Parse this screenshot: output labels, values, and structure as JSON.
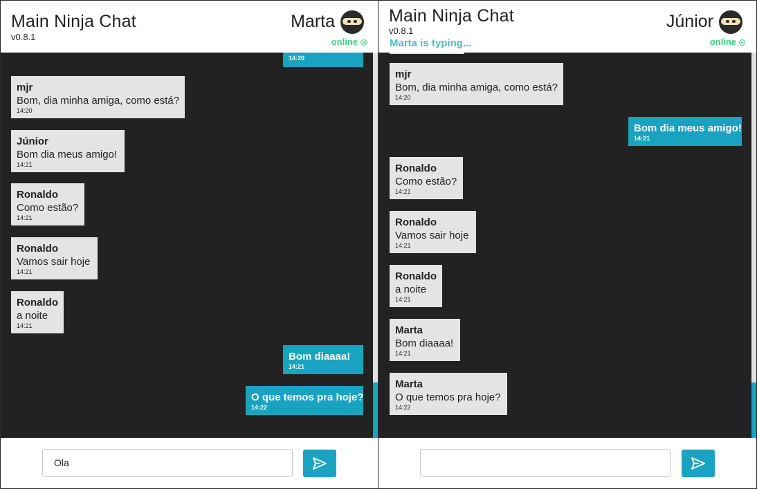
{
  "left": {
    "app_title": "Main Ninja Chat",
    "version": "v0.8.1",
    "user_name": "Marta",
    "status": "online",
    "partial_time": "14:20",
    "messages": [
      {
        "author": "mjr",
        "text": "Bom, dia minha amiga, como está?",
        "time": "14:20",
        "mine": false
      },
      {
        "author": "Júnior",
        "text": "Bom dia meus amigo!",
        "time": "14:21",
        "mine": false
      },
      {
        "author": "Ronaldo",
        "text": "Como estão?",
        "time": "14:21",
        "mine": false
      },
      {
        "author": "Ronaldo",
        "text": "Vamos sair hoje",
        "time": "14:21",
        "mine": false
      },
      {
        "author": "Ronaldo",
        "text": "a noite",
        "time": "14:21",
        "mine": false
      },
      {
        "text": "Bom diaaaa!",
        "time": "14:21",
        "mine": true
      },
      {
        "text": "O que temos pra hoje?",
        "time": "14:22",
        "mine": true
      }
    ],
    "input_value": "Ola"
  },
  "right": {
    "app_title": "Main Ninja Chat",
    "version": "v0.8.1",
    "typing_indicator": "Marta is typing...",
    "user_name": "Júnior",
    "status": "online",
    "messages": [
      {
        "author": "mjr",
        "text": "Bom, dia minha amiga, como está?",
        "time": "14:20",
        "mine": false
      },
      {
        "text": "Bom dia meus amigo!",
        "time": "14:21",
        "mine": true
      },
      {
        "author": "Ronaldo",
        "text": "Como estão?",
        "time": "14:21",
        "mine": false
      },
      {
        "author": "Ronaldo",
        "text": "Vamos sair hoje",
        "time": "14:21",
        "mine": false
      },
      {
        "author": "Ronaldo",
        "text": "a noite",
        "time": "14:21",
        "mine": false
      },
      {
        "author": "Marta",
        "text": "Bom diaaaa!",
        "time": "14:21",
        "mine": false
      },
      {
        "author": "Marta",
        "text": "O que temos pra hoje?",
        "time": "14:22",
        "mine": false
      }
    ],
    "input_value": ""
  },
  "colors": {
    "accent": "#1aa3c1",
    "chat_background": "#222222",
    "bubble": "#e4e4e4",
    "online": "#3cd37a",
    "typing": "#4bbdc6"
  },
  "icons": {
    "avatar": "ninja-avatar-icon",
    "status": "online-dot-icon",
    "send": "send-icon"
  }
}
